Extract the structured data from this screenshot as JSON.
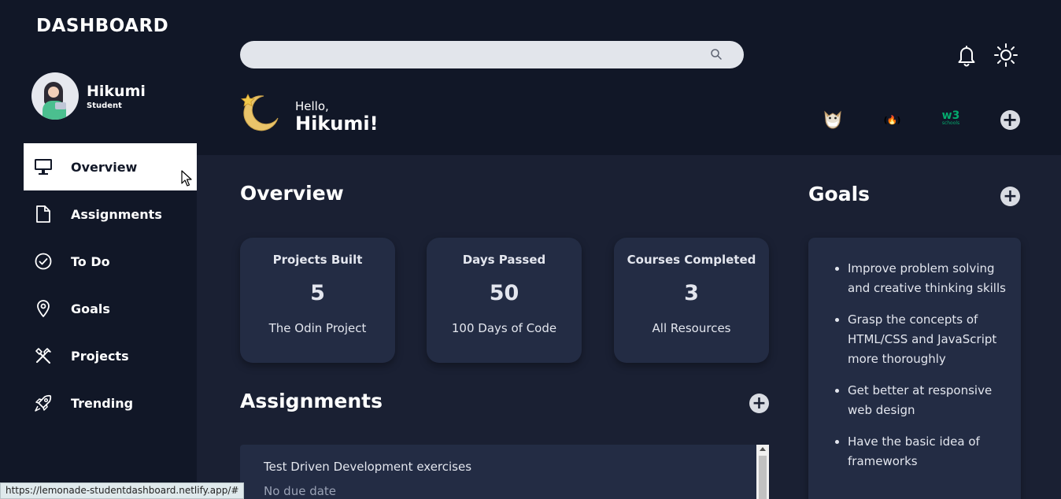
{
  "sidebar": {
    "brand": "DASHBOARD",
    "profile": {
      "name": "Hikumi",
      "role": "Student"
    },
    "items": [
      {
        "label": "Overview",
        "icon": "monitor-icon",
        "active": true
      },
      {
        "label": "Assignments",
        "icon": "file-icon",
        "active": false
      },
      {
        "label": "To Do",
        "icon": "check-circle-icon",
        "active": false
      },
      {
        "label": "Goals",
        "icon": "map-pin-icon",
        "active": false
      },
      {
        "label": "Projects",
        "icon": "tools-icon",
        "active": false
      },
      {
        "label": "Trending",
        "icon": "rocket-icon",
        "active": false
      }
    ]
  },
  "header": {
    "search": {
      "placeholder": "",
      "value": ""
    },
    "greeting": "Hello,",
    "greeting_name": "Hikumi!",
    "quick_links": [
      "codewars-icon",
      "freecodecamp-icon",
      "w3schools-icon"
    ],
    "w3_label": "w3",
    "w3_sub": "schools",
    "fcc_label": "(🔥)"
  },
  "overview": {
    "title": "Overview",
    "cards": [
      {
        "title": "Projects Built",
        "value": "5",
        "subtitle": "The Odin Project"
      },
      {
        "title": "Days Passed",
        "value": "50",
        "subtitle": "100 Days of Code"
      },
      {
        "title": "Courses Completed",
        "value": "3",
        "subtitle": "All Resources"
      }
    ]
  },
  "assignments": {
    "title": "Assignments",
    "items": [
      {
        "title": "Test Driven Development exercises",
        "due": "No due date"
      }
    ]
  },
  "goals": {
    "title": "Goals",
    "items": [
      "Improve problem solving and creative thinking skills",
      "Grasp the concepts of HTML/CSS and JavaScript more thoroughly",
      "Get better at responsive web design",
      "Have the basic idea of frameworks"
    ]
  },
  "status_bar": {
    "url": "https://lemonade-studentdashboard.netlify.app/#"
  },
  "colors": {
    "sidebar_bg": "#111727",
    "main_bg": "#1a2033",
    "card_bg": "#232c44",
    "accent": "#ffffff"
  }
}
